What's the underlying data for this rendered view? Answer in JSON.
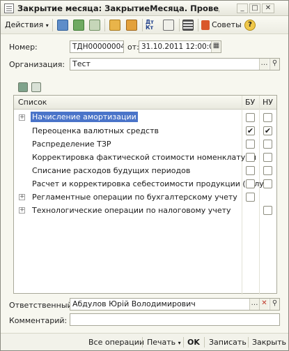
{
  "window": {
    "title": "Закрытие месяца: ЗакрытиеМесяца. Проведен"
  },
  "toolbar": {
    "actions_label": "Действия",
    "advice_label": "Советы",
    "help_glyph": "?",
    "colors": {
      "green_icon": "#4f9a45",
      "orange_icon": "#e39a2b",
      "blue_icon": "#3f78c2"
    }
  },
  "form": {
    "number_label": "Номер:",
    "number_value": "ТДН00000004",
    "from_label": "от:",
    "date_value": "31.10.2011 12:00:00",
    "organization_label": "Организация:",
    "organization_value": "Тест"
  },
  "table": {
    "headers": {
      "list": "Список",
      "bu": "БУ",
      "nu": "НУ"
    },
    "rows": [
      {
        "name": "Начисление амортизации",
        "expandable": true,
        "selected": true,
        "bu": false,
        "nu": false,
        "nu_shown": true
      },
      {
        "name": "Переоценка валютных средств",
        "expandable": false,
        "selected": false,
        "bu": true,
        "nu": true,
        "nu_shown": true
      },
      {
        "name": "Распределение ТЗР",
        "expandable": false,
        "selected": false,
        "bu": false,
        "nu": false,
        "nu_shown": true
      },
      {
        "name": "Корректировка фактической стоимости номенклатуры",
        "expandable": false,
        "selected": false,
        "bu": false,
        "nu": false,
        "nu_shown": true
      },
      {
        "name": "Списание расходов будущих периодов",
        "expandable": false,
        "selected": false,
        "bu": false,
        "nu": false,
        "nu_shown": true
      },
      {
        "name": "Расчет и корректировка себестоимости продукции (услуг)",
        "expandable": false,
        "selected": false,
        "bu": false,
        "nu": false,
        "nu_shown": true
      },
      {
        "name": "Регламентные операции по бухгалтерскому учету",
        "expandable": true,
        "selected": false,
        "bu": false,
        "nu": false,
        "nu_shown": false
      },
      {
        "name": "Технологические операции по налоговому учету",
        "expandable": true,
        "selected": false,
        "bu": null,
        "nu": false,
        "nu_shown": true
      }
    ]
  },
  "bottom": {
    "responsible_label": "Ответственный:",
    "responsible_value": "Абдулов Юрій Володимирович",
    "comment_label": "Комментарий:",
    "comment_value": ""
  },
  "footer": {
    "all_operations": "Все операции",
    "print": "Печать",
    "ok": "OK",
    "save": "Записать",
    "close": "Закрыть"
  }
}
